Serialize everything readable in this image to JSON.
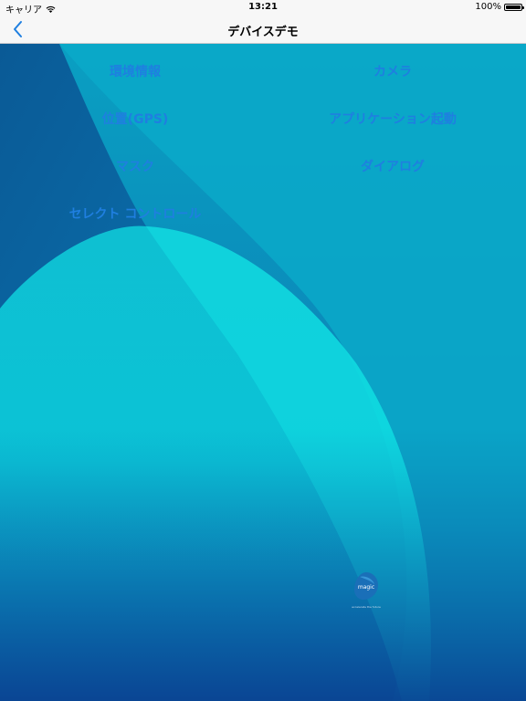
{
  "status_bar": {
    "carrier": "キャリア",
    "time": "13:21",
    "battery": "100%",
    "wifi_icon": "wifi-icon",
    "battery_icon": "battery-icon"
  },
  "nav": {
    "title": "デバイスデモ",
    "back_icon": "chevron-left-icon"
  },
  "menu": {
    "env_info": "環境情報",
    "camera": "カメラ",
    "gps": "位置(GPS)",
    "app_launch": "アプリケーション起動",
    "mask": "マスク",
    "dialog": "ダイアログ",
    "select_control": "セレクト コントロール"
  },
  "logo": {
    "name": "magic",
    "tagline": "accelerate the future"
  },
  "colors": {
    "accent": "#1f7fe0",
    "bar_bg": "#f7f7f7",
    "dark_blue": "#0a5b9a",
    "cyan": "#0fd3dc"
  }
}
